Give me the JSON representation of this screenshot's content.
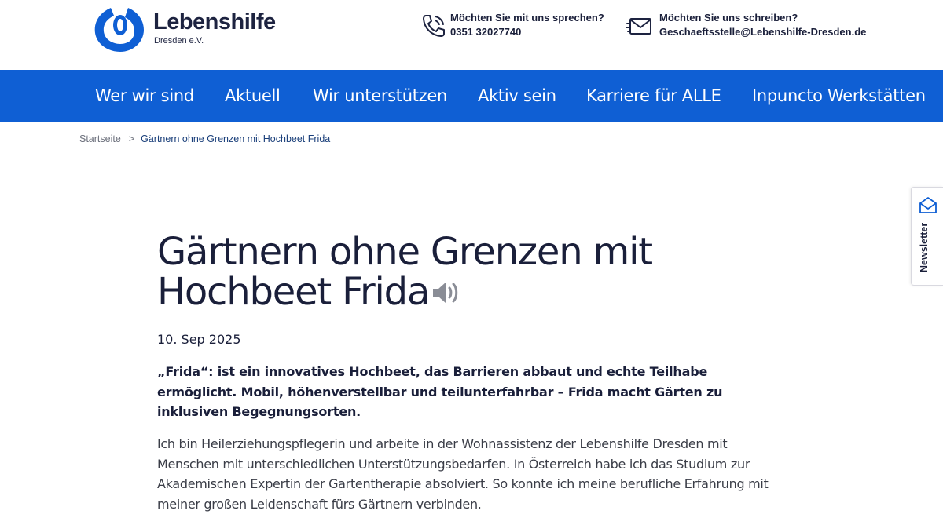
{
  "header": {
    "logo_name": "Lebenshilfe",
    "logo_sub": "Dresden e.V.",
    "brand_color": "#0f5fd4",
    "phone": {
      "title": "Möchten Sie mit uns sprechen?",
      "value": "0351 32027740",
      "icon": "phone-icon"
    },
    "mail": {
      "title": "Möchten Sie uns schreiben?",
      "value": "Geschaeftsstelle@Lebenshilfe-Dresden.de",
      "icon": "envelope-icon"
    }
  },
  "nav": {
    "items": [
      {
        "label": "Wer wir sind"
      },
      {
        "label": "Aktuell"
      },
      {
        "label": "Wir unterstützen"
      },
      {
        "label": "Aktiv sein"
      },
      {
        "label": "Karriere für ALLE"
      },
      {
        "label": "Inpuncto Werkstätten"
      }
    ]
  },
  "breadcrumb": {
    "home": "Startseite",
    "separator": ">",
    "current": "Gärtnern ohne Grenzen mit Hochbeet Frida"
  },
  "newsletter": {
    "label": "Newsletter",
    "icon": "newsletter-envelope-icon"
  },
  "article": {
    "title_line1": "Gärtnern ohne Grenzen mit",
    "title_line2": "Hochbeet Frida",
    "date": "10. Sep 2025",
    "lead": "„Frida“: ist ein innovatives Hochbeet, das Barrieren abbaut und echte Teilhabe ermöglicht. Mobil, höhenverstellbar und teilunterfahrbar – Frida macht Gärten zu inklusiven Begegnungsorten.",
    "body": "Ich bin Heilerziehungspflegerin und arbeite in der Wohnassistenz der Lebenshilfe Dresden mit Menschen mit unterschiedlichen Unterstützungsbedarfen. In Österreich habe ich das Studium zur Akademischen Expertin der Gartentherapie absolviert. So konnte ich meine berufliche Erfahrung mit meiner großen Leidenschaft fürs Gärtnern verbinden."
  }
}
